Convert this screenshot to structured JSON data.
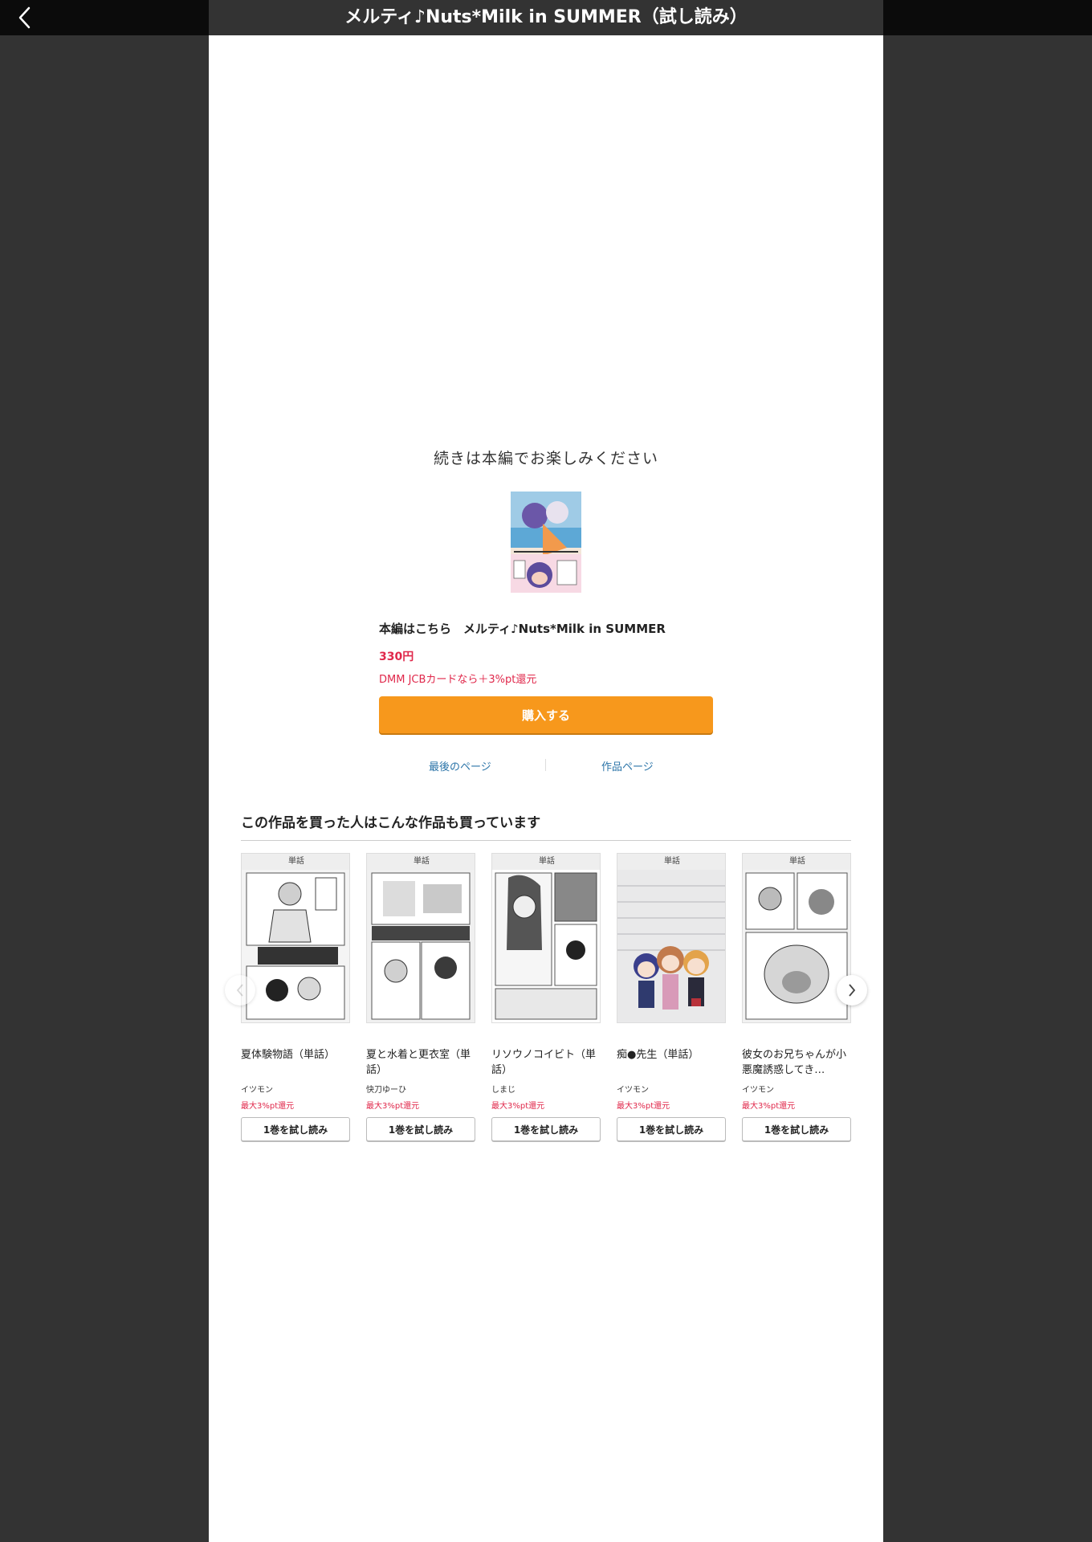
{
  "header": {
    "title": "メルティ♪Nuts*Milk in SUMMER（試し読み）",
    "back_icon": "chevron-left-icon"
  },
  "end_panel": {
    "message": "続きは本編でお楽しみください",
    "product_name": "本編はこちら　メルティ♪Nuts*Milk in SUMMER",
    "price": "330円",
    "point_note": "DMM JCBカードなら＋3%pt還元",
    "buy_label": "購入する",
    "last_page_label": "最後のページ",
    "product_page_label": "作品ページ"
  },
  "recommendations": {
    "title": "この作品を買った人はこんな作品も買っています",
    "items": [
      {
        "badge": "単話",
        "title": "夏体験物語（単話）",
        "author": "イツモン",
        "point": "最大3%pt還元",
        "button": "1巻を試し読み"
      },
      {
        "badge": "単話",
        "title": "夏と水着と更衣室（単話）",
        "author": "快刀ゆーひ",
        "point": "最大3%pt還元",
        "button": "1巻を試し読み"
      },
      {
        "badge": "単話",
        "title": "リソウノコイビト（単話）",
        "author": "しまじ",
        "point": "最大3%pt還元",
        "button": "1巻を試し読み"
      },
      {
        "badge": "単話",
        "title": "痴●先生（単話）",
        "author": "イツモン",
        "point": "最大3%pt還元",
        "button": "1巻を試し読み"
      },
      {
        "badge": "単話",
        "title": "彼女のお兄ちゃんが小悪魔誘惑してき…",
        "author": "イツモン",
        "point": "最大3%pt還元",
        "button": "1巻を試し読み"
      }
    ],
    "prev_icon": "chevron-left-icon",
    "next_icon": "chevron-right-icon"
  },
  "colors": {
    "accent_orange": "#f7981c",
    "price_red": "#e0284b",
    "link_blue": "#2b74a8",
    "frame_dark": "#333333"
  }
}
